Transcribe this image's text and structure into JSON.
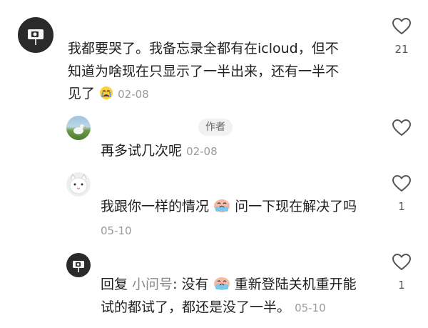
{
  "comments": [
    {
      "lines": [
        "我都要哭了。我备忘录全都有在icloud，但不",
        "知道为啥现在只显示了一半出来，还有一半不",
        "见了"
      ],
      "date": "02-08",
      "likes": "21",
      "emoji": "crying-face"
    }
  ],
  "replies": [
    {
      "text": "再多试几次呢",
      "date": "02-08",
      "tag": "作者",
      "likes": ""
    },
    {
      "text_before": "我跟你一样的情况",
      "text_after": "问一下现在解决了吗",
      "date": "05-10",
      "likes": "1",
      "emoji": "cry-sticker"
    },
    {
      "reply_prefix": "回复 ",
      "reply_to": "小问号",
      "text_before": ": 没有",
      "text_after": "重新登陆关机重开能",
      "line2": "试的都试了，都还是没了一半。",
      "date": "05-10",
      "likes": "1",
      "emoji": "cry-sticker"
    }
  ],
  "colors": {
    "text": "#1f1f1f",
    "muted": "#9a9a9a",
    "heart_outline": "#555555",
    "tag_bg": "#f1f1f1"
  }
}
